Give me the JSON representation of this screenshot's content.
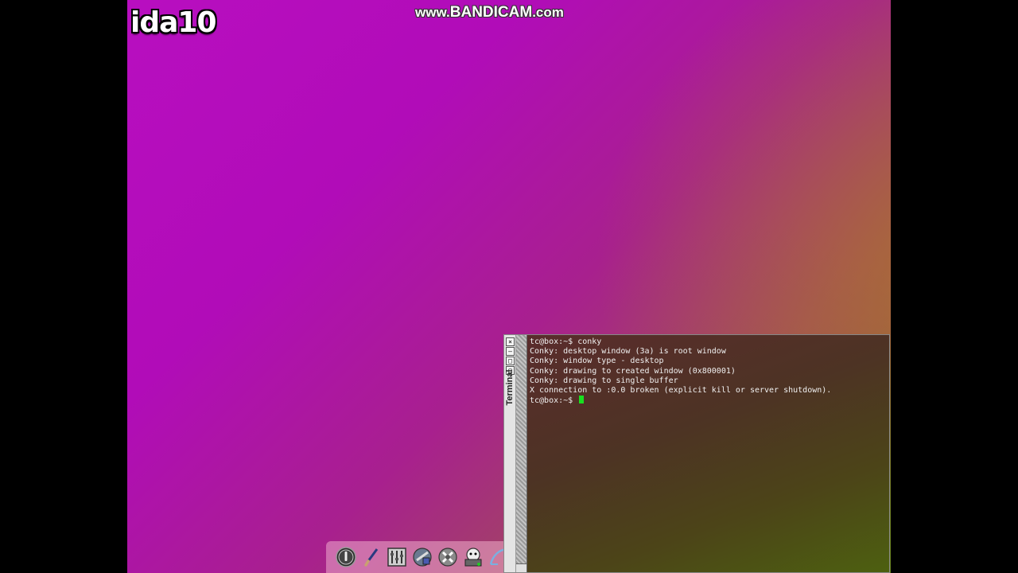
{
  "overlay": {
    "channel_tag": "ida10",
    "recorder_watermark_prefix": "www.",
    "recorder_watermark_brand": "BANDICAM",
    "recorder_watermark_suffix": ".com"
  },
  "desktop": {
    "colors": {
      "wallpaper_top": "#b80ec0",
      "wallpaper_bottom_right": "#5a8a14"
    }
  },
  "dock": {
    "icons": [
      {
        "name": "power-icon"
      },
      {
        "name": "paintbrush-icon"
      },
      {
        "name": "control-panel-icon"
      },
      {
        "name": "apps-browser-icon"
      },
      {
        "name": "settings-wrench-icon"
      },
      {
        "name": "mount-tool-icon"
      },
      {
        "name": "terminal-shell-icon"
      }
    ]
  },
  "terminal": {
    "title": "Terminal",
    "buttons": [
      "×",
      "–",
      "□",
      "▢"
    ],
    "lines": [
      "tc@box:~$ conky",
      "Conky: desktop window (3a) is root window",
      "Conky: window type - desktop",
      "Conky: drawing to created window (0x800001)",
      "Conky: drawing to single buffer",
      "X connection to :0.0 broken (explicit kill or server shutdown).",
      "tc@box:~$ "
    ],
    "cursor_color": "#18e020"
  }
}
